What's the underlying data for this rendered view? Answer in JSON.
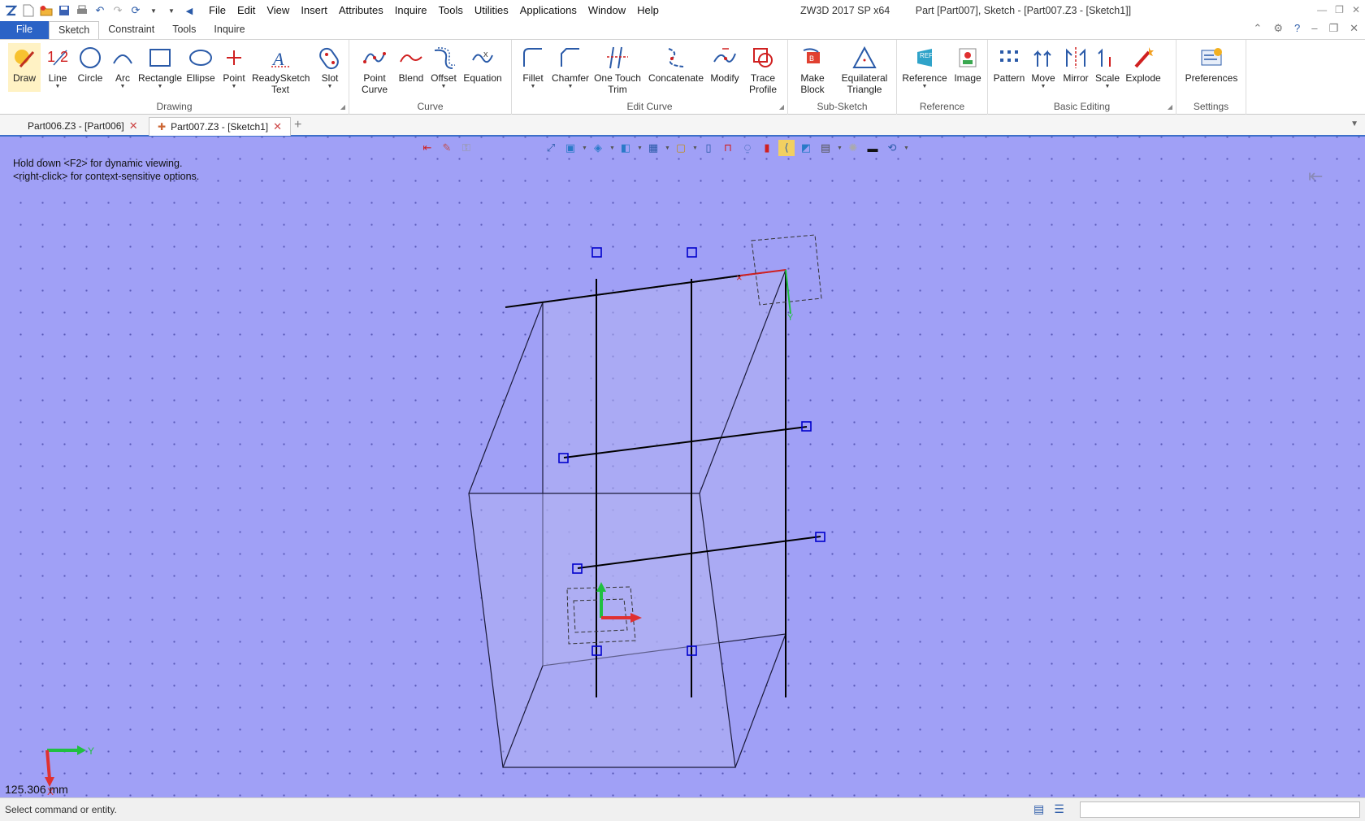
{
  "titlebar": {
    "app_name": "ZW3D 2017 SP x64",
    "document": "Part [Part007],  Sketch - [Part007.Z3 - [Sketch1]]",
    "menus": [
      "File",
      "Edit",
      "View",
      "Insert",
      "Attributes",
      "Inquire",
      "Tools",
      "Utilities",
      "Applications",
      "Window",
      "Help"
    ]
  },
  "ribbon_tabs": [
    "File",
    "Sketch",
    "Constraint",
    "Tools",
    "Inquire"
  ],
  "ribbon": {
    "drawing": {
      "label": "Drawing",
      "buttons": [
        "Draw",
        "Line",
        "Circle",
        "Arc",
        "Rectangle",
        "Ellipse",
        "Point",
        "ReadySketch Text",
        "Slot"
      ]
    },
    "curve": {
      "label": "Curve",
      "buttons": [
        "Point Curve",
        "Blend",
        "Offset",
        "Equation"
      ]
    },
    "edit_curve": {
      "label": "Edit Curve",
      "buttons": [
        "Fillet",
        "Chamfer",
        "One Touch Trim",
        "Concatenate",
        "Modify",
        "Trace Profile"
      ]
    },
    "sub_sketch": {
      "label": "Sub-Sketch",
      "buttons": [
        "Make Block",
        "Equilateral Triangle"
      ]
    },
    "reference": {
      "label": "Reference",
      "buttons": [
        "Reference",
        "Image"
      ]
    },
    "basic_editing": {
      "label": "Basic Editing",
      "buttons": [
        "Pattern",
        "Move",
        "Mirror",
        "Scale",
        "Explode"
      ]
    },
    "settings": {
      "label": "Settings",
      "buttons": [
        "Preferences"
      ]
    }
  },
  "document_tabs": [
    {
      "label": "Part006.Z3 - [Part006]",
      "active": false
    },
    {
      "label": "Part007.Z3 - [Sketch1]",
      "active": true
    }
  ],
  "viewport": {
    "hint_line1": "Hold down <F2> for dynamic viewing.",
    "hint_line2": "<right-click> for context-sensitive options.",
    "scale_readout": "125.306 mm",
    "axis_x_label": "X",
    "axis_y_label": "Y",
    "background_color": "#a0a0f6"
  },
  "statusbar": {
    "message": "Select command or entity."
  }
}
